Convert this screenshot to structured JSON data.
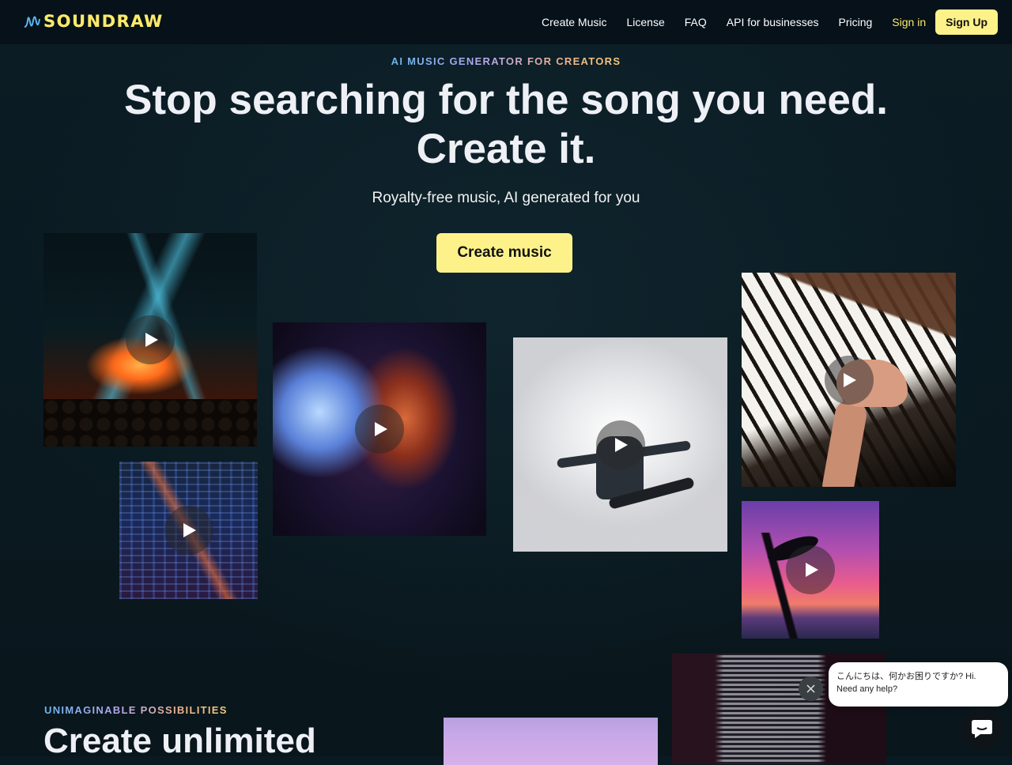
{
  "nav": {
    "logo_text": "SOUNDRAW",
    "links": [
      "Create Music",
      "License",
      "FAQ",
      "API for businesses",
      "Pricing"
    ],
    "sign_in": "Sign in",
    "sign_up": "Sign Up"
  },
  "hero": {
    "eyebrow": "AI MUSIC GENERATOR FOR CREATORS",
    "headline_line1": "Stop searching for the song you need.",
    "headline_line2": "Create it.",
    "subhead": "Royalty-free music, AI generated for you",
    "cta": "Create music"
  },
  "tiles": [
    {
      "icon": "play-icon",
      "subject": "concert lights"
    },
    {
      "icon": "play-icon",
      "subject": "city night"
    },
    {
      "icon": "play-icon",
      "subject": "disco ball"
    },
    {
      "icon": "play-icon",
      "subject": "dancer"
    },
    {
      "icon": "play-icon",
      "subject": "piano"
    },
    {
      "icon": "play-icon",
      "subject": "palm trees sunset"
    },
    {
      "icon": "play-icon",
      "subject": "microphone"
    },
    {
      "icon": "play-icon",
      "subject": "purple studio"
    }
  ],
  "section2": {
    "eyebrow": "UNIMAGINABLE POSSIBILITIES",
    "title": "Create unlimited"
  },
  "chat": {
    "message_line1": "こんにちは、何かお困りですか? Hi.",
    "message_line2": "Need any help?",
    "close_icon": "close-icon",
    "launcher_icon": "chat-icon"
  },
  "colors": {
    "accent": "#fdf28a",
    "background": "#0a1a22",
    "nav_bg": "#06111a"
  }
}
